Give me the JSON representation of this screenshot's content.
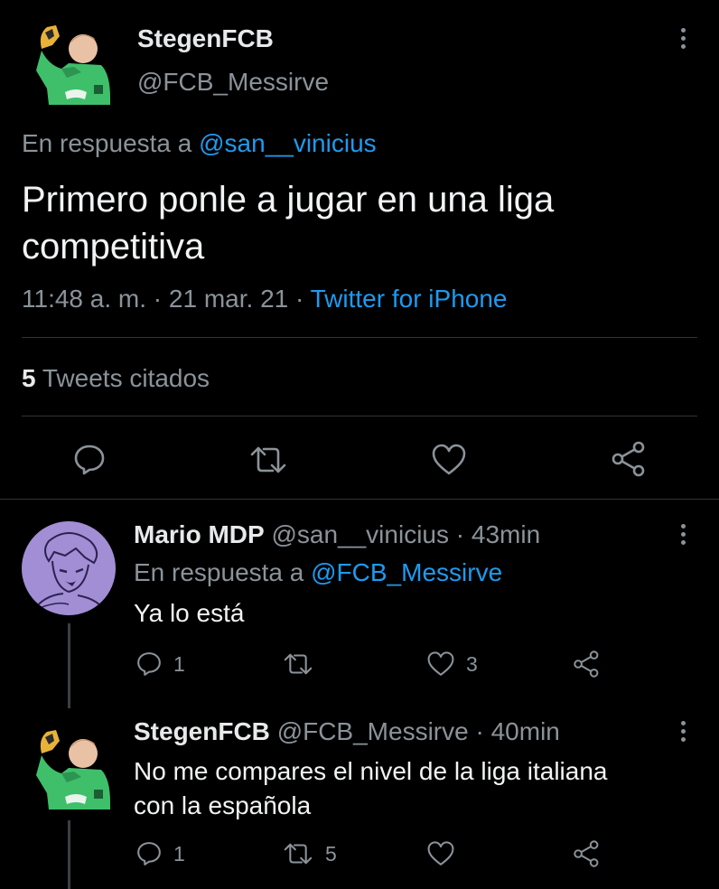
{
  "main_tweet": {
    "display_name": "StegenFCB",
    "handle": "@FCB_Messirve",
    "reply_prefix": "En respuesta a",
    "reply_handle": "@san__vinicius",
    "text_line1": "Primero ponle a jugar en una liga",
    "text_line2": "competitiva",
    "time": "11:48 a. m.",
    "date": "21 mar. 21",
    "separator": "·",
    "source": "Twitter for iPhone",
    "quote_count": "5",
    "quote_label": "Tweets citados",
    "avatar_icon": "goalkeeper-avatar-icon"
  },
  "replies": [
    {
      "display_name": "Mario MDP",
      "handle": "@san__vinicius",
      "sep": "·",
      "time": "43min",
      "reply_prefix": "En respuesta a",
      "reply_handle": "@FCB_Messirve",
      "text_line1": "Ya lo está",
      "text_line2": "",
      "reply_count": "1",
      "retweet_count": "",
      "like_count": "3",
      "avatar_icon": "anime-character-avatar-icon",
      "avatar_color": "#a18ed4"
    },
    {
      "display_name": "StegenFCB",
      "handle": "@FCB_Messirve",
      "sep": "·",
      "time": "40min",
      "reply_prefix": "",
      "reply_handle": "",
      "text_line1": "No me compares el nivel de la liga italiana",
      "text_line2": "con la española",
      "reply_count": "1",
      "retweet_count": "5",
      "like_count": "",
      "avatar_icon": "goalkeeper-avatar-icon"
    }
  ],
  "colors": {
    "background": "#000000",
    "text": "#e7e9ea",
    "muted": "#8b9399",
    "link": "#1d9bf0",
    "divider": "#2f3336"
  }
}
